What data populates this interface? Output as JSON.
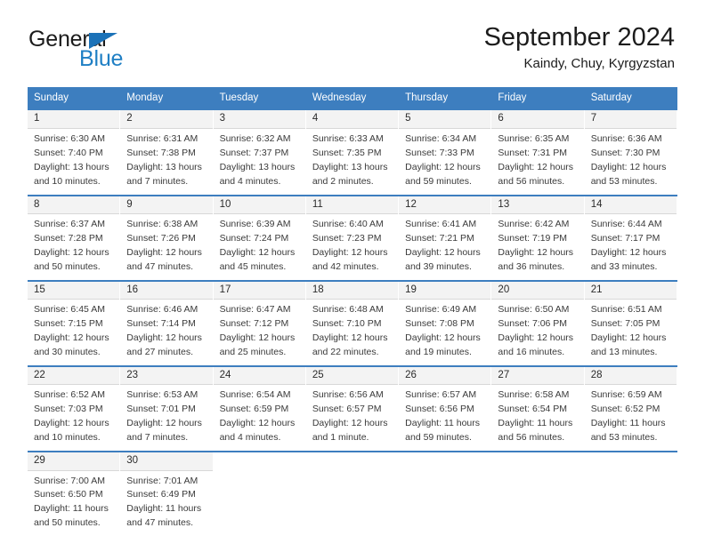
{
  "brand": {
    "name_primary": "General",
    "name_secondary": "Blue",
    "flag_icon": "triangle-flag-icon",
    "color_primary": "#1b1b1b",
    "color_secondary": "#1f7fc4"
  },
  "header": {
    "month_title": "September 2024",
    "location": "Kaindy, Chuy, Kyrgyzstan"
  },
  "theme": {
    "header_blue": "#3d7ebf",
    "day_band_gray": "#f3f3f3",
    "text_color": "#3a3a3a"
  },
  "weekdays": [
    "Sunday",
    "Monday",
    "Tuesday",
    "Wednesday",
    "Thursday",
    "Friday",
    "Saturday"
  ],
  "weeks": [
    [
      {
        "day": "1",
        "sunrise": "Sunrise: 6:30 AM",
        "sunset": "Sunset: 7:40 PM",
        "daylight": "Daylight: 13 hours and 10 minutes."
      },
      {
        "day": "2",
        "sunrise": "Sunrise: 6:31 AM",
        "sunset": "Sunset: 7:38 PM",
        "daylight": "Daylight: 13 hours and 7 minutes."
      },
      {
        "day": "3",
        "sunrise": "Sunrise: 6:32 AM",
        "sunset": "Sunset: 7:37 PM",
        "daylight": "Daylight: 13 hours and 4 minutes."
      },
      {
        "day": "4",
        "sunrise": "Sunrise: 6:33 AM",
        "sunset": "Sunset: 7:35 PM",
        "daylight": "Daylight: 13 hours and 2 minutes."
      },
      {
        "day": "5",
        "sunrise": "Sunrise: 6:34 AM",
        "sunset": "Sunset: 7:33 PM",
        "daylight": "Daylight: 12 hours and 59 minutes."
      },
      {
        "day": "6",
        "sunrise": "Sunrise: 6:35 AM",
        "sunset": "Sunset: 7:31 PM",
        "daylight": "Daylight: 12 hours and 56 minutes."
      },
      {
        "day": "7",
        "sunrise": "Sunrise: 6:36 AM",
        "sunset": "Sunset: 7:30 PM",
        "daylight": "Daylight: 12 hours and 53 minutes."
      }
    ],
    [
      {
        "day": "8",
        "sunrise": "Sunrise: 6:37 AM",
        "sunset": "Sunset: 7:28 PM",
        "daylight": "Daylight: 12 hours and 50 minutes."
      },
      {
        "day": "9",
        "sunrise": "Sunrise: 6:38 AM",
        "sunset": "Sunset: 7:26 PM",
        "daylight": "Daylight: 12 hours and 47 minutes."
      },
      {
        "day": "10",
        "sunrise": "Sunrise: 6:39 AM",
        "sunset": "Sunset: 7:24 PM",
        "daylight": "Daylight: 12 hours and 45 minutes."
      },
      {
        "day": "11",
        "sunrise": "Sunrise: 6:40 AM",
        "sunset": "Sunset: 7:23 PM",
        "daylight": "Daylight: 12 hours and 42 minutes."
      },
      {
        "day": "12",
        "sunrise": "Sunrise: 6:41 AM",
        "sunset": "Sunset: 7:21 PM",
        "daylight": "Daylight: 12 hours and 39 minutes."
      },
      {
        "day": "13",
        "sunrise": "Sunrise: 6:42 AM",
        "sunset": "Sunset: 7:19 PM",
        "daylight": "Daylight: 12 hours and 36 minutes."
      },
      {
        "day": "14",
        "sunrise": "Sunrise: 6:44 AM",
        "sunset": "Sunset: 7:17 PM",
        "daylight": "Daylight: 12 hours and 33 minutes."
      }
    ],
    [
      {
        "day": "15",
        "sunrise": "Sunrise: 6:45 AM",
        "sunset": "Sunset: 7:15 PM",
        "daylight": "Daylight: 12 hours and 30 minutes."
      },
      {
        "day": "16",
        "sunrise": "Sunrise: 6:46 AM",
        "sunset": "Sunset: 7:14 PM",
        "daylight": "Daylight: 12 hours and 27 minutes."
      },
      {
        "day": "17",
        "sunrise": "Sunrise: 6:47 AM",
        "sunset": "Sunset: 7:12 PM",
        "daylight": "Daylight: 12 hours and 25 minutes."
      },
      {
        "day": "18",
        "sunrise": "Sunrise: 6:48 AM",
        "sunset": "Sunset: 7:10 PM",
        "daylight": "Daylight: 12 hours and 22 minutes."
      },
      {
        "day": "19",
        "sunrise": "Sunrise: 6:49 AM",
        "sunset": "Sunset: 7:08 PM",
        "daylight": "Daylight: 12 hours and 19 minutes."
      },
      {
        "day": "20",
        "sunrise": "Sunrise: 6:50 AM",
        "sunset": "Sunset: 7:06 PM",
        "daylight": "Daylight: 12 hours and 16 minutes."
      },
      {
        "day": "21",
        "sunrise": "Sunrise: 6:51 AM",
        "sunset": "Sunset: 7:05 PM",
        "daylight": "Daylight: 12 hours and 13 minutes."
      }
    ],
    [
      {
        "day": "22",
        "sunrise": "Sunrise: 6:52 AM",
        "sunset": "Sunset: 7:03 PM",
        "daylight": "Daylight: 12 hours and 10 minutes."
      },
      {
        "day": "23",
        "sunrise": "Sunrise: 6:53 AM",
        "sunset": "Sunset: 7:01 PM",
        "daylight": "Daylight: 12 hours and 7 minutes."
      },
      {
        "day": "24",
        "sunrise": "Sunrise: 6:54 AM",
        "sunset": "Sunset: 6:59 PM",
        "daylight": "Daylight: 12 hours and 4 minutes."
      },
      {
        "day": "25",
        "sunrise": "Sunrise: 6:56 AM",
        "sunset": "Sunset: 6:57 PM",
        "daylight": "Daylight: 12 hours and 1 minute."
      },
      {
        "day": "26",
        "sunrise": "Sunrise: 6:57 AM",
        "sunset": "Sunset: 6:56 PM",
        "daylight": "Daylight: 11 hours and 59 minutes."
      },
      {
        "day": "27",
        "sunrise": "Sunrise: 6:58 AM",
        "sunset": "Sunset: 6:54 PM",
        "daylight": "Daylight: 11 hours and 56 minutes."
      },
      {
        "day": "28",
        "sunrise": "Sunrise: 6:59 AM",
        "sunset": "Sunset: 6:52 PM",
        "daylight": "Daylight: 11 hours and 53 minutes."
      }
    ],
    [
      {
        "day": "29",
        "sunrise": "Sunrise: 7:00 AM",
        "sunset": "Sunset: 6:50 PM",
        "daylight": "Daylight: 11 hours and 50 minutes."
      },
      {
        "day": "30",
        "sunrise": "Sunrise: 7:01 AM",
        "sunset": "Sunset: 6:49 PM",
        "daylight": "Daylight: 11 hours and 47 minutes."
      },
      {
        "day": "",
        "sunrise": "",
        "sunset": "",
        "daylight": ""
      },
      {
        "day": "",
        "sunrise": "",
        "sunset": "",
        "daylight": ""
      },
      {
        "day": "",
        "sunrise": "",
        "sunset": "",
        "daylight": ""
      },
      {
        "day": "",
        "sunrise": "",
        "sunset": "",
        "daylight": ""
      },
      {
        "day": "",
        "sunrise": "",
        "sunset": "",
        "daylight": ""
      }
    ]
  ]
}
